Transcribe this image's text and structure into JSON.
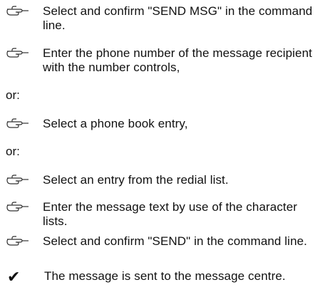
{
  "steps": [
    {
      "icon": "pointing-hand-icon",
      "text": "Select and confirm \"SEND MSG\" in the command line."
    },
    {
      "icon": "pointing-hand-icon",
      "text": "Enter the phone number of the message recipient with the number controls,"
    },
    {
      "icon": "pointing-hand-icon",
      "text": "Select a phone book entry,"
    },
    {
      "icon": "pointing-hand-icon",
      "text": "Select an entry from the redial list."
    },
    {
      "icon": "pointing-hand-icon",
      "text": "Enter the message text by use of the character lists."
    },
    {
      "icon": "pointing-hand-icon",
      "text": "Select and confirm \"SEND\" in the command line."
    }
  ],
  "or_labels": [
    "or:",
    "or:"
  ],
  "result": {
    "icon": "checkmark-icon",
    "symbol": "✔",
    "text": "The message is sent to the message centre."
  }
}
